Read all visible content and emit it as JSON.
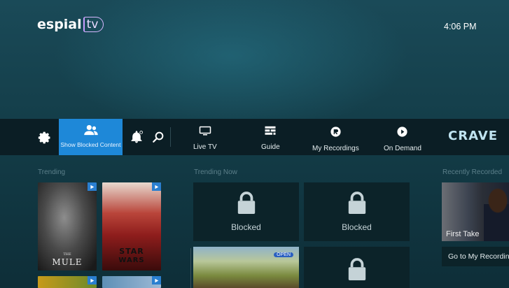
{
  "header": {
    "logo_word": "espial",
    "logo_tv": "tv",
    "clock": "4:06 PM"
  },
  "nav": {
    "show_blocked_label": "Show Blocked Content",
    "items": [
      {
        "label": "Live TV",
        "icon": "tv-icon"
      },
      {
        "label": "Guide",
        "icon": "guide-icon"
      },
      {
        "label": "My Recordings",
        "icon": "recordings-icon"
      },
      {
        "label": "On Demand",
        "icon": "play-circle-icon"
      }
    ],
    "crave_label": "CRAVE"
  },
  "sections": {
    "trending": {
      "title": "Trending",
      "posters": [
        {
          "title_small": "THE",
          "title_big": "MULE"
        },
        {
          "title_top": "STAR",
          "title_bottom": "WARS"
        }
      ]
    },
    "trending_now": {
      "title": "Trending Now",
      "blocked_label": "Blocked",
      "channel_badge": "OPEN"
    },
    "recently_recorded": {
      "title": "Recently Recorded",
      "thumb_label": "First Take",
      "goto_label": "Go to My Recordings"
    }
  },
  "colors": {
    "accent": "#1e88d8",
    "nav_bg": "#0b1e25",
    "tile_bg": "#0c2329"
  }
}
